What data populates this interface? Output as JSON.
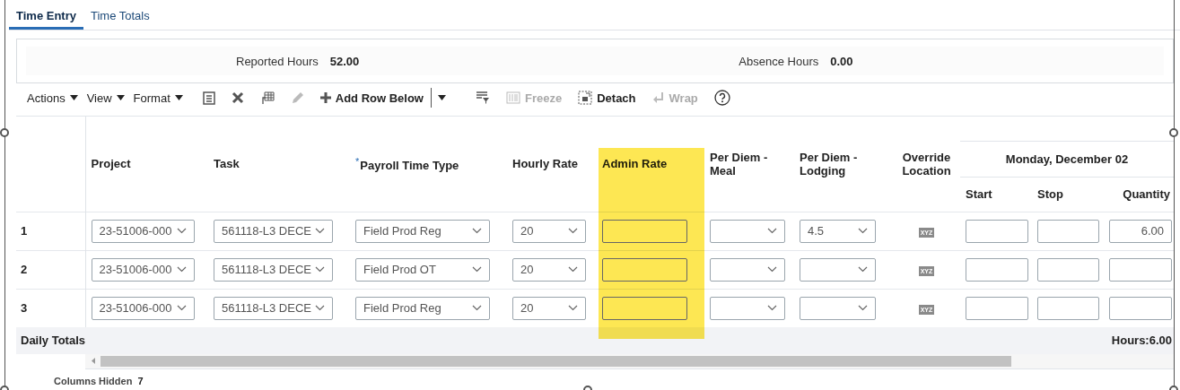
{
  "tabs": [
    {
      "label": "Time Entry",
      "selected": true
    },
    {
      "label": "Time Totals",
      "selected": false
    }
  ],
  "summary": [
    {
      "label": "Reported Hours",
      "value": "52.00"
    },
    {
      "label": "Absence Hours",
      "value": "0.00"
    }
  ],
  "toolbar": [
    {
      "kind": "menu",
      "label": "Actions"
    },
    {
      "kind": "menu",
      "label": "View"
    },
    {
      "kind": "menu",
      "label": "Format"
    },
    {
      "kind": "list",
      "disabled": false
    },
    {
      "kind": "delete",
      "disabled": false
    },
    {
      "kind": "grid",
      "disabled": false
    },
    {
      "kind": "edit",
      "disabled": true
    },
    {
      "kind": "add",
      "label": "Add Row Below",
      "disabled": false
    },
    {
      "kind": "split",
      "disabled": false
    },
    {
      "kind": "filter",
      "disabled": false
    },
    {
      "kind": "freeze",
      "label": "Freeze",
      "disabled": true
    },
    {
      "kind": "detach",
      "label": "Detach",
      "disabled": false
    },
    {
      "kind": "wrap",
      "label": "Wrap",
      "disabled": true
    },
    {
      "kind": "help",
      "disabled": false
    }
  ],
  "table": {
    "columns": [
      {
        "label": "Project",
        "kind": "select"
      },
      {
        "label": "Task",
        "kind": "select"
      },
      {
        "label": "$^{*}$Payroll Time Type",
        "kind": "select"
      },
      {
        "label": "Hourly Rate",
        "kind": "select"
      },
      {
        "label": "Admin Rate",
        "kind": "text",
        "highlighted": true
      },
      {
        "label": "Per Diem - Meal",
        "kind": "select"
      },
      {
        "label": "Per Diem - Lodging",
        "kind": "select"
      },
      {
        "label": "Override Location",
        "kind": "badge"
      }
    ],
    "day": {
      "label": "Monday, December 02",
      "columns": [
        {
          "label": "Start",
          "kind": "text"
        },
        {
          "label": "Stop",
          "kind": "text"
        },
        {
          "label": "Quantity",
          "kind": "number"
        }
      ]
    },
    "rows": [
      {
        "number": "1",
        "cells": [
          {
            "value": "23-51006-000"
          },
          {
            "value": "561118-L3 DECE"
          },
          {
            "value": "Field Prod Reg"
          },
          {
            "value": "20"
          },
          {},
          {},
          {
            "value": "4.5"
          },
          {
            "value": "XYZ"
          },
          {},
          {},
          {
            "value": "6.00"
          }
        ]
      },
      {
        "number": "2",
        "cells": [
          {
            "value": "23-51006-000"
          },
          {
            "value": "561118-L3 DECE"
          },
          {
            "value": "Field Prod OT"
          },
          {
            "value": "20"
          },
          {},
          {},
          {},
          {
            "value": "XYZ"
          },
          {},
          {},
          {}
        ]
      },
      {
        "number": "3",
        "cells": [
          {
            "value": "23-51006-000"
          },
          {
            "value": "561118-L3 DECE"
          },
          {
            "value": "Field Prod Reg"
          },
          {
            "value": "20"
          },
          {},
          {},
          {},
          {
            "value": "XYZ"
          },
          {},
          {},
          {}
        ]
      }
    ],
    "totals": {
      "label": "Daily Totals",
      "hours": "Hours:6.00"
    }
  },
  "footer": {
    "label": "Columns Hidden",
    "value": "7"
  }
}
